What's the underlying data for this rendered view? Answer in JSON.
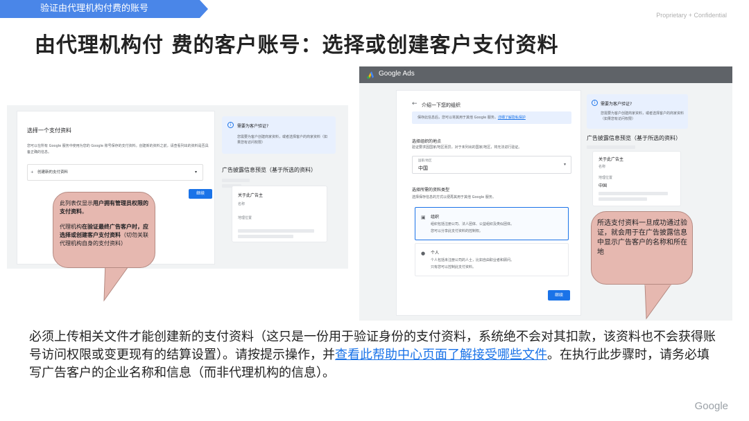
{
  "slide": {
    "tag": "验证由代理机构付费的账号",
    "proprietary": "Proprietary + Confidential",
    "title": "由代理机构付 费的客户账号：选择或创建客户支付资料",
    "google_logo": "Google"
  },
  "left_shot": {
    "heading": "选择一个支付资料",
    "desc": "您可以在所有 Google 服务中使用为您的 Google 账号保存的支付资料。创建新的资料之前，请查看列出的资料是否具备正确的信息。",
    "select_label": "创建新的支付资料",
    "plus_icon": "+",
    "continue_btn": "继续",
    "info_title": "需要为客户验证?",
    "info_desc": "您需要为客户创建商家资料，或者选择客户的商家资料（如果您有访问权限）",
    "preview_title": "广告披露信息预览（基于所选的资料）",
    "advertiser_heading": "关于此广告主",
    "name_label": "名称",
    "location_label": "地理位置"
  },
  "bubble_left": {
    "line1_pre": "此列表仅显示",
    "line1_bold": "用户拥有管理员权限的支付资料",
    "line1_post": "。",
    "line2_pre": "代理机构",
    "line2_bold": "在验证最终广告客户时，应选择或创建客户支付资料",
    "line2_post": "（切勿关联代理机构自身的支付资料）"
  },
  "right_shot": {
    "app_name": "Google Ads",
    "back_arrow": "←",
    "card_title": "介绍一下您的组织",
    "alert_text": "保存此信息后，您可以将其用于其他 Google 服务。",
    "alert_link": "详细了解隐私保护",
    "location_section": "选择组织的地点",
    "location_sub": "验证要求因国家/地区而异，对于未列出的国家/地区，将无法进行验证。",
    "field_label": "国家/地区",
    "field_value": "中国",
    "type_section": "选择所需的资料类型",
    "type_sub": "选择保存信息的方式以便再其用于其他 Google 服务。",
    "org_title": "组织",
    "org_desc1": "组织包括注册公司、法人团体、公益组织及类似团体。",
    "org_desc2": "您可以分享此支付资料的控制权。",
    "person_title": "个人",
    "person_desc1": "个人包括未注册公司的人士，比如自由职业者和顾问。",
    "person_desc2": "只有您可以控制此支付资料。",
    "continue_btn": "继续",
    "info_title": "需要为客户验证?",
    "info_desc": "您需要为客户创建商家资料，或者选择客户的商家资料（如果您有访问权限）",
    "preview_title": "广告披露信息预览（基于所选的资料）",
    "advertiser_heading": "关于此广告主",
    "name_label": "名称",
    "location_label": "地理位置",
    "location_value": "中国"
  },
  "bubble_right": {
    "text": "所选支付资料一旦成功通过验证，就会用于在广告披露信息中显示广告客户的名称和所在地"
  },
  "body": {
    "part1": "必须上传相关文件才能创建新的支付资料（这只是一份用于验证身份的支付资料，系统绝不会对其扣款，该资料也不会获得账号访问权限或变更现有的结算设置）。请按提示操作，并",
    "link": "查看此帮助中心页面了解接受哪些文件",
    "part2": "。在执行此步骤时，请务必填写广告客户的企业名称和信息（而非代理机构的信息）。"
  },
  "colors": {
    "tag_blue": "#4a86e8",
    "link_blue": "#1a73e8",
    "bubble_fill": "#e6b8b0",
    "info_bg": "#e8f0fe"
  }
}
